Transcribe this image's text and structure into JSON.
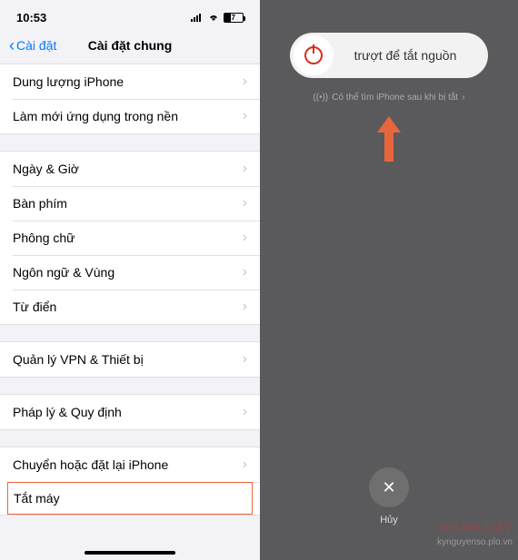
{
  "statusbar": {
    "time": "10:53",
    "battery": "37"
  },
  "nav": {
    "back": "Cài đặt",
    "title": "Cài đặt chung"
  },
  "group1": [
    {
      "label": "Dung lượng iPhone"
    },
    {
      "label": "Làm mới ứng dụng trong nền"
    }
  ],
  "group2": [
    {
      "label": "Ngày & Giờ"
    },
    {
      "label": "Bàn phím"
    },
    {
      "label": "Phông chữ"
    },
    {
      "label": "Ngôn ngữ & Vùng"
    },
    {
      "label": "Từ điển"
    }
  ],
  "group3": [
    {
      "label": "Quản lý VPN & Thiết bị"
    }
  ],
  "group4": [
    {
      "label": "Pháp lý & Quy định"
    }
  ],
  "group5": [
    {
      "label": "Chuyển hoặc đặt lại iPhone"
    },
    {
      "label": "Tắt máy",
      "highlighted": true
    }
  ],
  "shutdown": {
    "slider": "trượt để tắt nguồn",
    "find": "Có thể tìm iPhone sau khi bị tắt",
    "cancel": "Hủy"
  },
  "watermark": {
    "main": "PHÁPLUẬT",
    "sub": "kynguyenso.plo.vn"
  }
}
